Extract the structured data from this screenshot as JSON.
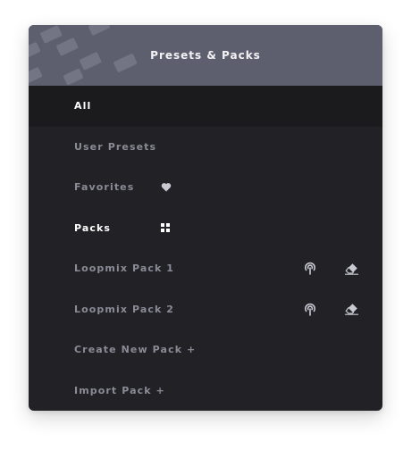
{
  "panel": {
    "title": "Presets & Packs"
  },
  "items": [
    {
      "label": "All",
      "selected": true
    },
    {
      "label": "User Presets"
    },
    {
      "label": "Favorites",
      "icon": "heart-icon"
    },
    {
      "label": "Packs",
      "icon": "grid-icon"
    },
    {
      "label": "Loopmix Pack 1",
      "actions": [
        "broadcast-icon",
        "eraser-icon"
      ]
    },
    {
      "label": "Loopmix Pack 2",
      "actions": [
        "broadcast-icon",
        "eraser-icon"
      ]
    },
    {
      "label": "Create New Pack +"
    },
    {
      "label": "Import Pack +"
    }
  ],
  "colors": {
    "panel_bg": "#222226",
    "header_bg": "#5d5f6e",
    "selected_row_bg": "#1b1b1e",
    "muted_text": "#8a8b96",
    "bright_text": "#ffffff",
    "icon": "#c8c9d2"
  }
}
